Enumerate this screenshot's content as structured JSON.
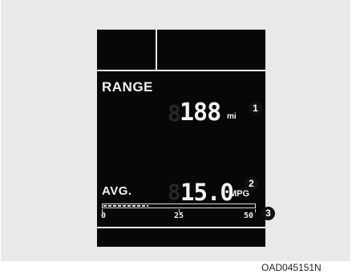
{
  "display": {
    "range": {
      "label": "RANGE",
      "value": "188",
      "unit": "mi"
    },
    "avg": {
      "label": "AVG.",
      "value": "15.0",
      "unit": "MPG"
    },
    "bar": {
      "scale_min": "0",
      "scale_mid": "25",
      "scale_max": "50",
      "fill_fraction": 0.3
    }
  },
  "callouts": {
    "one": "1",
    "two": "2",
    "three": "3"
  },
  "caption": "OAD045151N"
}
